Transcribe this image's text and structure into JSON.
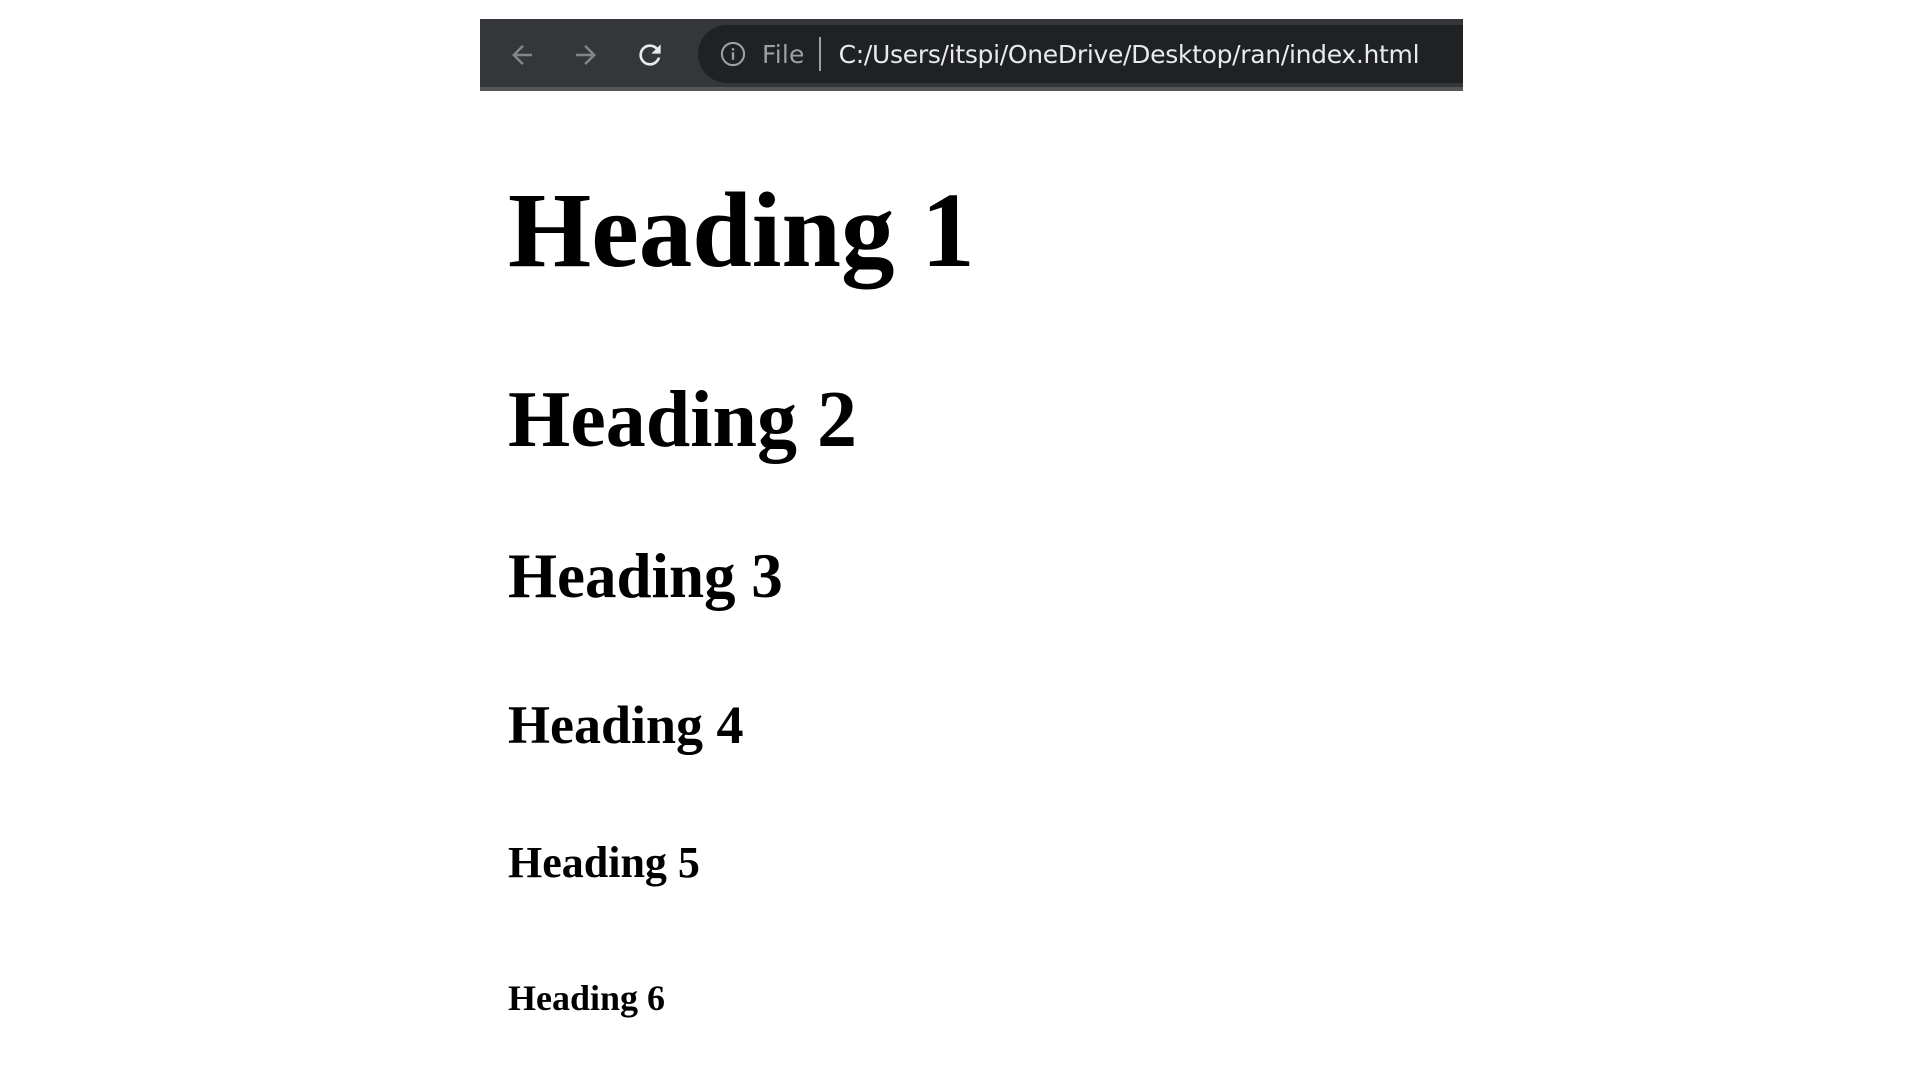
{
  "browser": {
    "nav": {
      "back_icon": "arrow-left-icon",
      "forward_icon": "arrow-right-icon",
      "reload_icon": "reload-icon"
    },
    "address_bar": {
      "info_icon": "info-circle-icon",
      "scheme_label": "File",
      "url": "C:/Users/itspi/OneDrive/Desktop/ran/index.html"
    },
    "colors": {
      "toolbar_bg": "#35363a",
      "omnibox_bg": "#202124",
      "url_text": "#e8eaed",
      "muted_text": "#9aa0a6"
    }
  },
  "page": {
    "headings": {
      "h1": "Heading 1",
      "h2": "Heading 2",
      "h3": "Heading 3",
      "h4": "Heading 4",
      "h5": "Heading 5",
      "h6": "Heading 6"
    }
  }
}
